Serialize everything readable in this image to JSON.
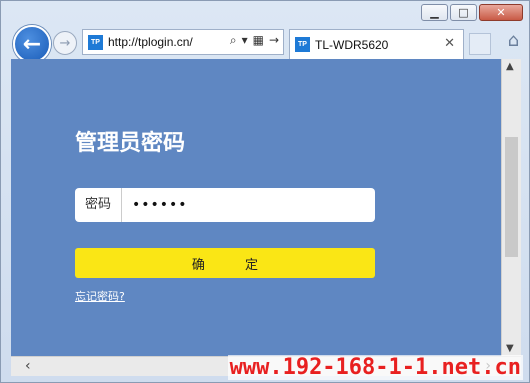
{
  "window": {
    "controls": {
      "minimize": "▁",
      "maximize": "□",
      "close": "✕"
    }
  },
  "navbar": {
    "back_icon": "back-arrow-icon",
    "forward_icon": "forward-arrow-icon",
    "address": {
      "favicon_text": "TP",
      "url": "http://tplogin.cn/"
    },
    "tab": {
      "favicon_text": "TP",
      "title": "TL-WDR5620"
    }
  },
  "page": {
    "title": "管理员密码",
    "password": {
      "label": "密码",
      "value": "••••••"
    },
    "confirm_button": "确 定",
    "forgot_link": "忘记密码?",
    "background_color": "#5f87c2",
    "button_color": "#fae615"
  },
  "watermark": "www.192-168-1-1.net.cn"
}
